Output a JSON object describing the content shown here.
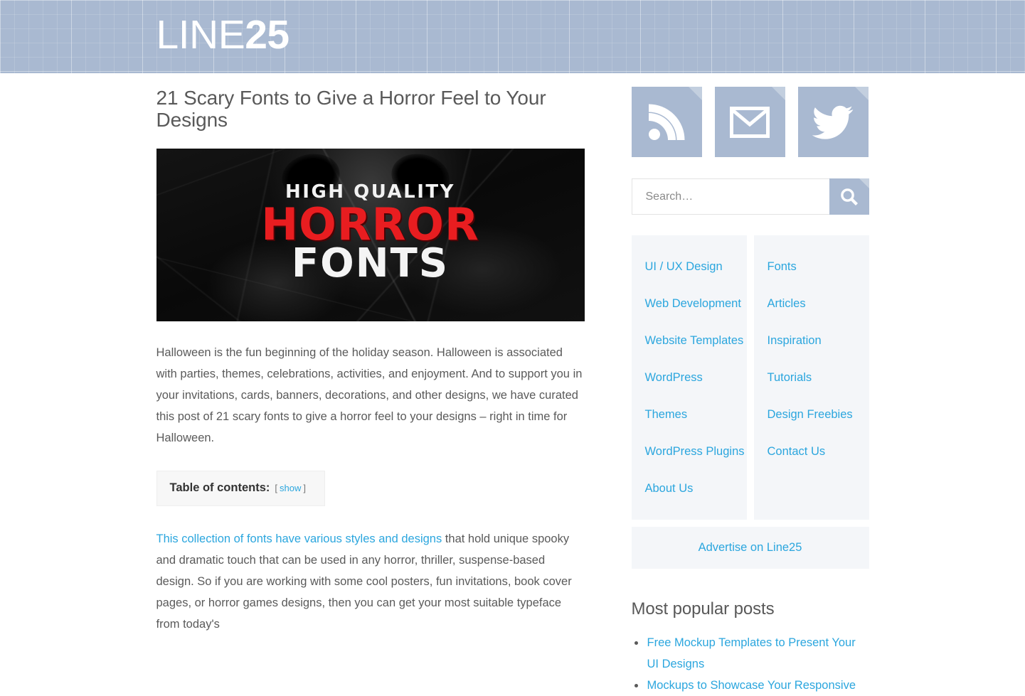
{
  "header": {
    "logo_light": "LINE",
    "logo_bold": "25",
    "background_color": "#a9b9d1"
  },
  "colors": {
    "link_blue": "#2ba6de",
    "toc_link_blue": "#1e73be",
    "accent_blue_gray": "#a9b9d1",
    "panel_gray": "#f4f6f9",
    "body_text": "#5a5a5a",
    "horror_red": "#e81d20"
  },
  "article": {
    "title": "21 Scary Fonts to Give a Horror Feel to Your Designs",
    "featured_image": {
      "line1": "HIGH QUALITY",
      "line2": "HORROR",
      "line3": "FONTS"
    },
    "paragraph1": "Halloween is the fun beginning of the holiday season. Halloween is associated with parties, themes, celebrations, activities, and enjoyment. And to support you in your invitations, cards, banners, decorations, and other designs, we have curated this post of 21 scary fonts to give a horror feel to your designs – right in time for Halloween.",
    "toc": {
      "label": "Table of contents:",
      "bracket_open": "[",
      "toggle": "show",
      "bracket_close": "]"
    },
    "paragraph2_link": "This collection of fonts have various styles and designs",
    "paragraph2_rest": " that hold unique spooky and dramatic touch that can be used in any horror, thriller, suspense-based design. So if you are working with some cool posters, fun invitations, book cover pages, or horror games designs, then you can get your most suitable typeface from today's"
  },
  "sidebar": {
    "social": [
      {
        "name": "rss-icon",
        "label": "RSS"
      },
      {
        "name": "email-icon",
        "label": "Email"
      },
      {
        "name": "twitter-icon",
        "label": "Twitter"
      }
    ],
    "search": {
      "placeholder": "Search…",
      "value": "",
      "icon": "search-icon"
    },
    "categories_left": [
      "UI / UX Design",
      "Web Development",
      "Website Templates",
      "WordPress Themes",
      "WordPress Plugins",
      "About Us"
    ],
    "categories_right": [
      "Fonts",
      "Articles",
      "Inspiration",
      "Tutorials",
      "Design Freebies",
      "Contact Us"
    ],
    "advertise": "Advertise on Line25",
    "popular_heading": "Most popular posts",
    "popular_posts": [
      "Free Mockup Templates to Present Your UI Designs",
      "Mockups to Showcase Your Responsive"
    ]
  }
}
